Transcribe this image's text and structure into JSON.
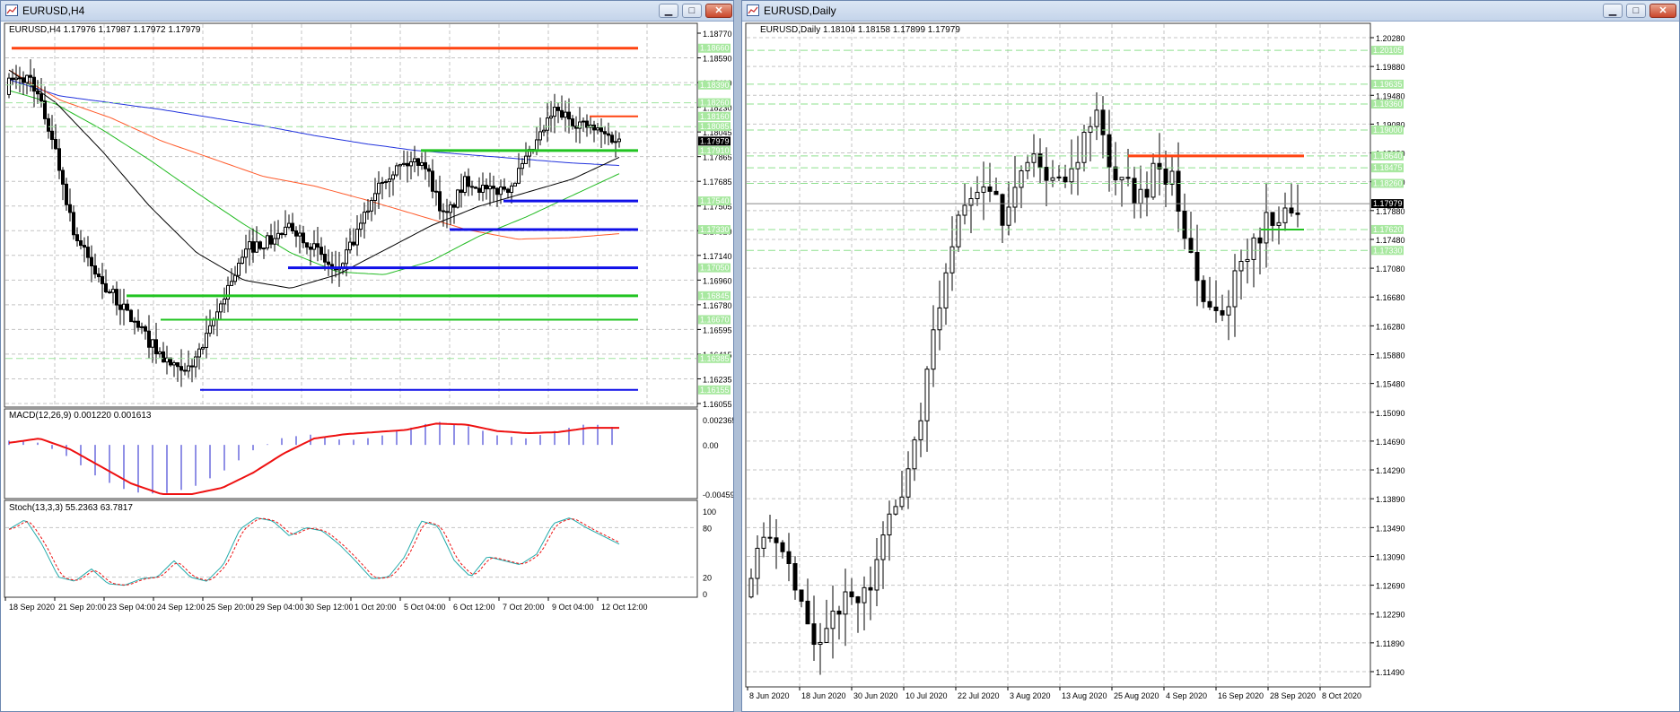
{
  "left_window": {
    "title": "EURUSD,H4",
    "chart_header": "EURUSD,H4  1.17976 1.17987 1.17972 1.17979",
    "price_ticks": [
      "1.18770",
      "1.18590",
      "1.18410",
      "1.18230",
      "1.18045",
      "1.17865",
      "1.17685",
      "1.17505",
      "1.17320",
      "1.17140",
      "1.16960",
      "1.16780",
      "1.16595",
      "1.16415",
      "1.16235",
      "1.16055"
    ],
    "level_labels": [
      "1.18660",
      "1.18390",
      "1.18260",
      "1.18160",
      "1.18085",
      "1.17910",
      "1.17540",
      "1.17330",
      "1.17050",
      "1.16845",
      "1.16670",
      "1.16385",
      "1.16155"
    ],
    "current_price": "1.17979",
    "time_ticks": [
      "18 Sep 2020",
      "21 Sep 20:00",
      "23 Sep 04:00",
      "24 Sep 12:00",
      "25 Sep 20:00",
      "29 Sep 04:00",
      "30 Sep 12:00",
      "1 Oct 20:00",
      "5 Oct 04:00",
      "6 Oct 12:00",
      "7 Oct 20:00",
      "9 Oct 04:00",
      "12 Oct 12:00"
    ],
    "macd_header": "MACD(12,26,9) 0.001220 0.001613",
    "macd_ticks": [
      "0.002365",
      "0.00",
      "-0.004599"
    ],
    "stoch_header": "Stoch(13,3,3) 55.2363 63.7817",
    "stoch_ticks": [
      "100",
      "80",
      "20",
      "0"
    ]
  },
  "right_window": {
    "title": "EURUSD,Daily",
    "chart_header": "EURUSD,Daily  1.18104 1.18158 1.17899 1.17979",
    "price_ticks": [
      "1.20280",
      "1.19880",
      "1.19480",
      "1.19080",
      "1.18680",
      "1.18280",
      "1.17880",
      "1.17480",
      "1.17080",
      "1.16680",
      "1.16280",
      "1.15880",
      "1.15480",
      "1.15090",
      "1.14690",
      "1.14290",
      "1.13890",
      "1.13490",
      "1.13090",
      "1.12690",
      "1.12290",
      "1.11890",
      "1.11490"
    ],
    "level_labels": [
      "1.20105",
      "1.19635",
      "1.19360",
      "1.19000",
      "1.18640",
      "1.18475",
      "1.18260",
      "1.17620",
      "1.17330"
    ],
    "current_price": "1.17979",
    "time_ticks": [
      "8 Jun 2020",
      "18 Jun 2020",
      "30 Jun 2020",
      "10 Jul 2020",
      "22 Jul 2020",
      "3 Aug 2020",
      "13 Aug 2020",
      "25 Aug 2020",
      "4 Sep 2020",
      "16 Sep 2020",
      "28 Sep 2020",
      "8 Oct 2020"
    ]
  },
  "window_buttons": {
    "minimize": "▁",
    "maximize": "□",
    "close": "✕"
  },
  "colors": {
    "bull_candle": "#ffffff",
    "bear_candle": "#000000",
    "support_line": "#22c422",
    "resistance_line": "#ff4411",
    "key_level": "#1010e8",
    "ma_blue": "#2233dd",
    "ma_orange": "#ff5a2a",
    "ma_green": "#22bb22",
    "ma_black": "#000000",
    "label_bg": "#a8e8a0",
    "macd_signal": "#ee1111",
    "macd_hist": "#2222cc",
    "stoch_main": "#22aaaa",
    "stoch_signal": "#ee1111",
    "grid": "#c4c4c4"
  }
}
